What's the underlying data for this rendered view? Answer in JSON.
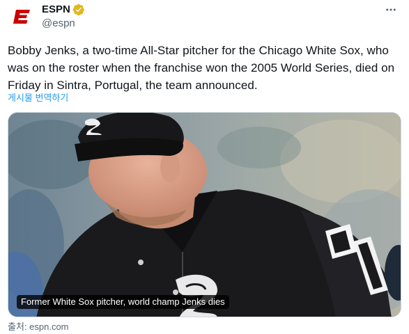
{
  "account": {
    "display_name": "ESPN",
    "handle": "@espn",
    "avatar_icon": "espn-logo-icon",
    "verified_icon": "gold-verified-badge-icon",
    "brand_color": "#cc0000",
    "verified_color": "#e2b719"
  },
  "tweet": {
    "text": "Bobby Jenks, a two-time All-Star pitcher for the Chicago White Sox, who was on the roster when the franchise won the 2005 World Series, died on Friday in Sintra, Portugal, the team announced.",
    "translate_label": "게시물 번역하기"
  },
  "card": {
    "image_description_icon": "baseball-pitcher-photo",
    "caption": "Former White Sox pitcher, world champ Jenks dies",
    "source": "출처: espn.com"
  },
  "menu": {
    "more_icon": "more-options-icon"
  },
  "colors": {
    "link": "#1d9bf0",
    "secondary_text": "#536471",
    "primary_text": "#0f1419"
  }
}
